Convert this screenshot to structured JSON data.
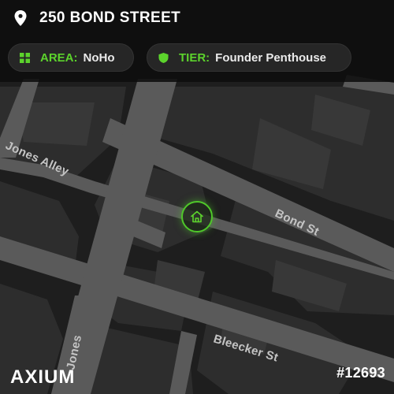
{
  "location": {
    "address": "250 BOND STREET",
    "pin_icon": "map-pin-icon"
  },
  "pills": {
    "area": {
      "key": "AREA:",
      "value": "NoHo",
      "icon": "grid-icon"
    },
    "tier": {
      "key": "TIER:",
      "value": "Founder Penthouse",
      "icon": "shield-icon"
    }
  },
  "map": {
    "streets": [
      "Jones Alley",
      "Bond St",
      "Bleecker St",
      "Jones"
    ],
    "marker_icon": "home-icon"
  },
  "brand": {
    "name": "AXIUM"
  },
  "token": {
    "id": "#12693"
  },
  "colors": {
    "accent": "#5cd32c",
    "background": "#202020",
    "road": "#5a5a5a",
    "building": "#2f2f2f"
  }
}
